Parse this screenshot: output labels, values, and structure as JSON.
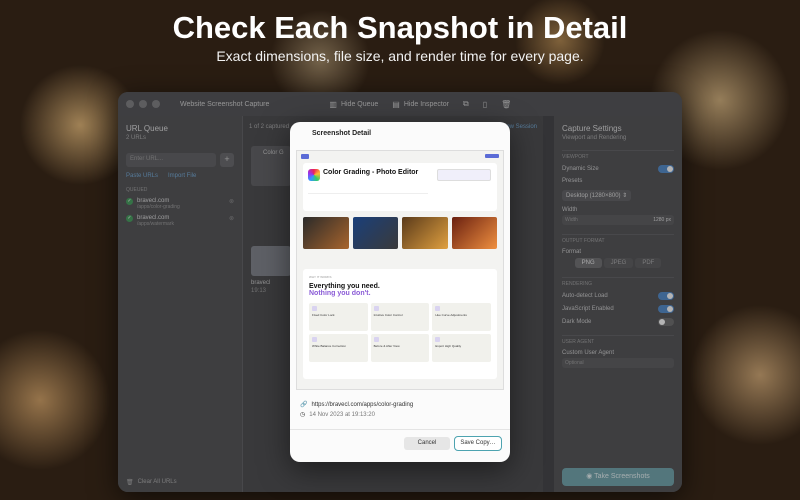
{
  "hero": {
    "title": "Check Each Snapshot in Detail",
    "subtitle": "Exact dimensions, file size, and render time for every page."
  },
  "window": {
    "title": "Website Screenshot Capture",
    "toolbar": {
      "hide_queue": "Hide Queue",
      "hide_inspector": "Hide Inspector"
    }
  },
  "sidebar": {
    "title": "URL Queue",
    "count": "2 URLs",
    "url_placeholder": "Enter URL...",
    "add_label": "+",
    "paste_urls": "Paste URLs",
    "import_file": "Import File",
    "queued_label": "QUEUED",
    "items": [
      {
        "name": "bravecl.com",
        "path": "/apps/color-grading"
      },
      {
        "name": "bravecl.com",
        "path": "/apps/watermark"
      }
    ],
    "clear_all": "Clear All URLs"
  },
  "middle": {
    "captured": "1 of 2 captured",
    "new_session": "New Session",
    "card_label": "Color G",
    "card2_name": "bravecl",
    "card2_time": "19:13"
  },
  "inspector": {
    "title": "Capture Settings",
    "subtitle": "Viewport and Rendering",
    "viewport_label": "VIEWPORT",
    "dynamic_size": "Dynamic Size",
    "dynamic_size_on": true,
    "presets_label": "Presets",
    "preset_value": "Desktop (1280×800)",
    "width_label": "Width",
    "width_field": "Width",
    "width_value": "1280",
    "width_unit": "px",
    "output_label": "OUTPUT FORMAT",
    "format_label": "Format",
    "formats": [
      "PNG",
      "JPEG",
      "PDF"
    ],
    "format_selected": "PNG",
    "rendering_label": "RENDERING",
    "auto_detect": "Auto-detect Load",
    "javascript": "JavaScript Enabled",
    "dark_mode": "Dark Mode",
    "user_agent_label": "USER AGENT",
    "custom_ua": "Custom User Agent",
    "ua_placeholder": "Optional",
    "take_button": "Take Screenshots"
  },
  "modal": {
    "title": "Screenshot Detail",
    "url": "https://bravecl.com/apps/color-grading",
    "timestamp": "14 Nov 2023 at 19:13:20",
    "cancel": "Cancel",
    "save": "Save Copy…",
    "preview": {
      "heading": "Color Grading - Photo Editor",
      "features_eyebrow": "WHY IT WORKS",
      "features_h1": "Everything you need.",
      "features_h2": "Nothing you don't.",
      "features": [
        "Fixed Color Lock",
        "Intuitive Color Control",
        "Hue Curve Adjustments",
        "White Balance Correction",
        "Before & After View",
        "Export High Quality"
      ]
    }
  },
  "icons": {
    "link": "link-icon",
    "clock": "clock-icon",
    "camera": "camera-icon",
    "trash": "trash-icon"
  },
  "colors": {
    "accent": "#4da3b0",
    "toggle_on": "#4a86c8",
    "check": "#3c9a55",
    "highlight_purple": "#8a5bd6"
  }
}
